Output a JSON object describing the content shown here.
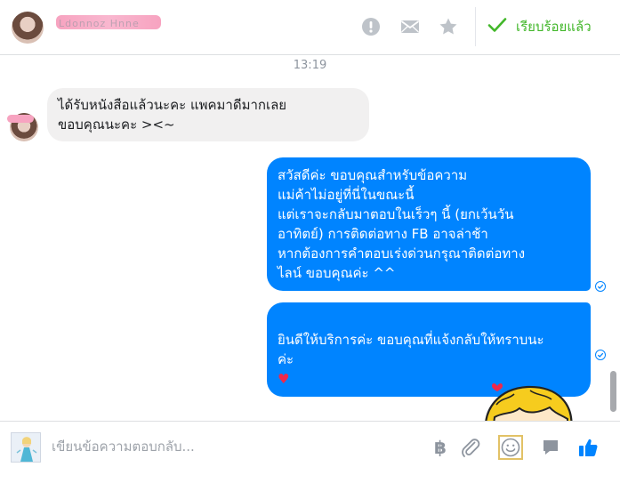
{
  "header": {
    "contact_name": "Ldonnoz Hnne",
    "done_label": "เรียบร้อยแล้ว",
    "icons": [
      "alert-icon",
      "mail-icon",
      "star-icon",
      "check-icon"
    ]
  },
  "thread": {
    "timestamp": "13:19",
    "messages": [
      {
        "direction": "incoming",
        "text": "ได้รับหนังสือแล้วนะคะ แพคมาดีมากเลย\nขอบคุณนะคะ ><~"
      },
      {
        "direction": "outgoing",
        "text": "สวัสดีค่ะ ขอบคุณสำหรับข้อความ\nแม่ค้าไม่อยู่ที่นี่ในขณะนี้\nแต่เราจะกลับมาตอบในเร็วๆ นี้ (ยกเว้นวัน\nอาทิตย์) การติดต่อทาง FB อาจล่าช้า\n หากต้องการคำตอบเร่งด่วนกรุณาติดต่อทาง\nไลน์ ขอบคุณค่ะ ^^"
      },
      {
        "direction": "outgoing",
        "text": "ยินดีให้บริการค่ะ ขอบคุณที่แจ้งกลับให้ทราบนะ\nค่ะ",
        "emoji": "♥"
      }
    ]
  },
  "composer": {
    "placeholder": "เขียนข้อความตอบกลับ...",
    "value": "",
    "icons": [
      "baht-icon",
      "attachment-icon",
      "emoji-icon",
      "sticker-icon",
      "like-icon"
    ],
    "baht_symbol": "฿"
  },
  "colors": {
    "accent_blue": "#0084ff",
    "done_green": "#42b72a",
    "incoming_bubble": "#f1f0f0",
    "heart": "#f0284a",
    "icon_gray": "#8d949e"
  }
}
